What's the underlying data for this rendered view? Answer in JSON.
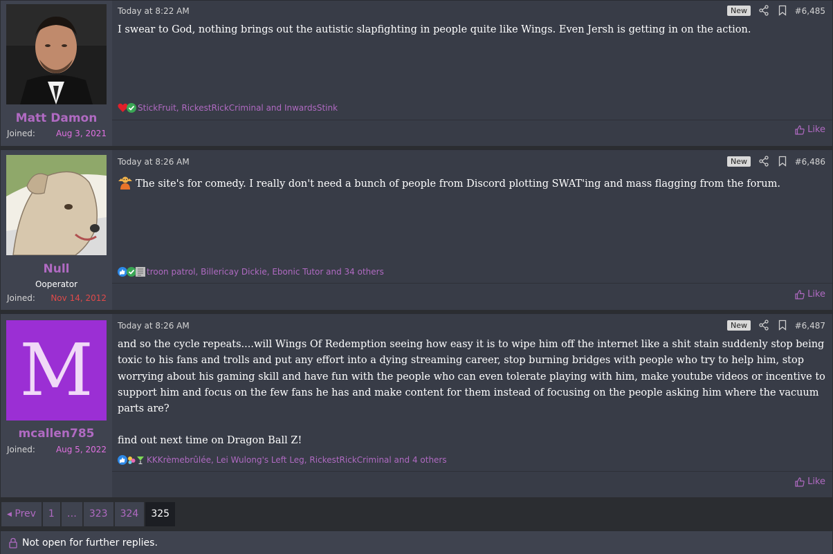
{
  "posts": [
    {
      "username": "Matt Damon",
      "user_title": "",
      "joined_label": "Joined:",
      "joined_date": "Aug 3, 2021",
      "time": "Today at 8:22 AM",
      "badge": "New",
      "post_number": "#6,485",
      "message": [
        "I swear to God, nothing brings out the autistic slapfighting in people quite like Wings. Even Jersh is getting in on the action."
      ],
      "reaction_icons": [
        "heart-icon",
        "check-icon"
      ],
      "reactions_text": "StickFruit, RickestRickCriminal and InwardsStink",
      "like_label": "Like"
    },
    {
      "username": "Null",
      "user_title": "Ooperator",
      "joined_label": "Joined:",
      "joined_date": "Nov 14, 2012",
      "time": "Today at 8:26 AM",
      "badge": "New",
      "post_number": "#6,486",
      "message": [
        "The site's for comedy. I really don't need a bunch of people from Discord plotting SWAT'ing and mass flagging from the forum."
      ],
      "reaction_icons": [
        "thumbs-up-icon",
        "check-icon",
        "newspaper-icon"
      ],
      "reactions_text": "troon patrol, Billericay Dickie, Ebonic Tutor and 34 others",
      "like_label": "Like"
    },
    {
      "username": "mcallen785",
      "user_title": "",
      "joined_label": "Joined:",
      "joined_date": "Aug 5, 2022",
      "avatar_letter": "M",
      "time": "Today at 8:26 AM",
      "badge": "New",
      "post_number": "#6,487",
      "message": [
        "and so the cycle repeats....will Wings Of Redemption seeing how easy it is to wipe him off the internet like a shit stain suddenly stop being toxic to his fans and trolls and put any effort into a dying streaming career, stop burning bridges with people who try to help him, stop worrying about his gaming skill and have fun with the people who can even tolerate playing with him, make youtube videos or incentive to support him and focus on the few fans he has and make content for them instead of focusing on the people asking him where the vacuum parts are?",
        "find out next time on Dragon Ball Z!"
      ],
      "reaction_icons": [
        "thumbs-up-icon",
        "flowers-icon",
        "cocktail-icon"
      ],
      "reactions_text": "KKKrèmebrûlée, Lei Wulong's Left Leg, RickestRickCriminal and 4 others",
      "like_label": "Like"
    }
  ],
  "pagination": {
    "prev_label": "Prev",
    "pages": [
      "1",
      "…",
      "323",
      "324",
      "325"
    ],
    "current": "325"
  },
  "thread_status": "Not open for further replies.",
  "colors": {
    "username": "#b06ac2",
    "joined_date_1": "#e070e0",
    "joined_date_2": "#e04a4a",
    "joined_date_3": "#e070e0",
    "avatar_3_bg": "#9b2fd4"
  }
}
